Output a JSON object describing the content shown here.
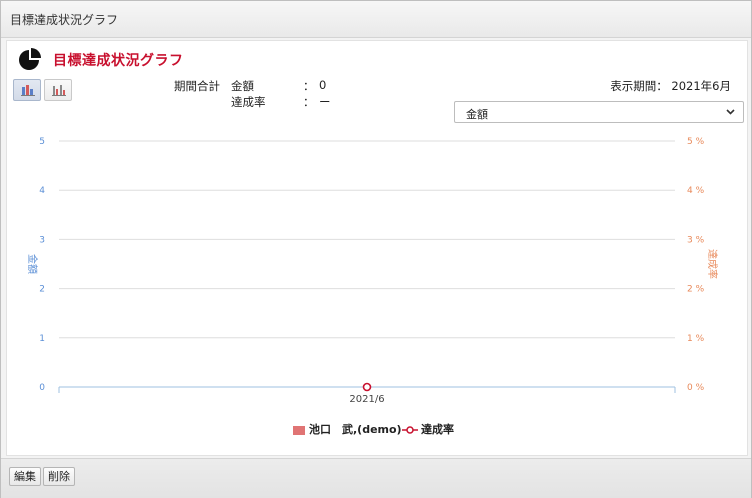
{
  "window": {
    "title": "目標達成状況グラフ"
  },
  "panel": {
    "title": "目標達成状況グラフ"
  },
  "summary": {
    "label": "期間合計",
    "amount_label": "金額",
    "amount_sep": "：",
    "amount_value": "0",
    "rate_label": "達成率",
    "rate_sep": "：",
    "rate_value": "ー"
  },
  "period": {
    "text": "表示期間： 2021年6月"
  },
  "select": {
    "value": "金額"
  },
  "chart_data": {
    "type": "bar",
    "categories": [
      "2021/6"
    ],
    "series": [
      {
        "name": "池口　武,(demo)",
        "type": "bar",
        "axis": "left",
        "values": [
          0
        ],
        "color": "#e07474"
      },
      {
        "name": "達成率",
        "type": "line",
        "axis": "right",
        "values": [
          0
        ],
        "color": "#c8102e"
      }
    ],
    "ylabel": "金額",
    "ylabel_right": "達成率",
    "ylim": [
      0,
      5
    ],
    "ylim_right": [
      0,
      5
    ],
    "yticks": [
      "0",
      "1",
      "2",
      "3",
      "4",
      "5"
    ],
    "yticks_right": [
      "0 %",
      "1 %",
      "2 %",
      "3 %",
      "4 %",
      "5 %"
    ],
    "grid": true,
    "legend": "bottom"
  },
  "footer": {
    "edit_label": "編集",
    "delete_label": "削除"
  }
}
